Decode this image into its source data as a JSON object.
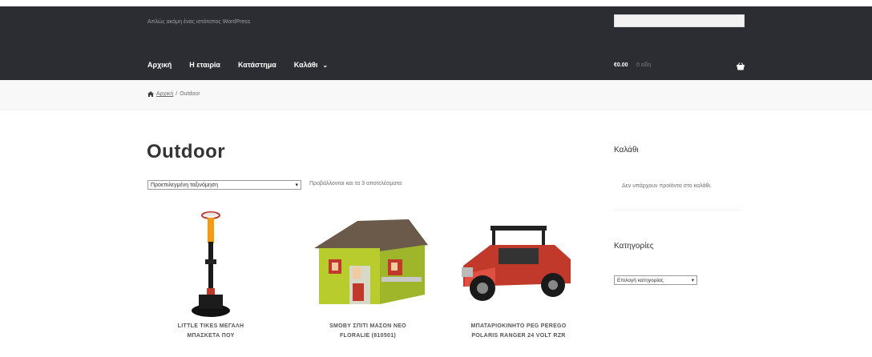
{
  "header": {
    "tagline": "Απλώς ακόμη ένας ιστότοπος WordPress",
    "nav": [
      {
        "label": "Αρχική"
      },
      {
        "label": "Η εταιρία"
      },
      {
        "label": "Κατάστημα"
      },
      {
        "label": "Καλάθι"
      }
    ],
    "cart_amount": "€0.00",
    "cart_items": "0 είδη"
  },
  "breadcrumb": {
    "home": "Αρχική",
    "separator": "/",
    "current": "Outdoor"
  },
  "main": {
    "title": "Outdoor",
    "sort_selected": "Προεπιλεγμένη ταξινόμηση",
    "result_count": "Προβάλλονται και τα 3 αποτελέσματα",
    "products": [
      {
        "title_line1": "LITTLE TIKES ΜΕΓΑΛΗ",
        "title_line2": "ΜΠΑΣΚΕΤΑ ΠΟΥ",
        "image": "basketball-hoop"
      },
      {
        "title_line1": "SMOBY ΣΠΙΤΙ ΜΑΣΟΝ ΝΕΟ",
        "title_line2": "FLORALIE (810501)",
        "image": "playhouse"
      },
      {
        "title_line1": "ΜΠΑΤΑΡΙΟΚΙΝΗΤΟ PEG PEREGO",
        "title_line2": "POLARIS RANGER 24 VOLT RZR",
        "image": "toy-jeep"
      }
    ]
  },
  "sidebar": {
    "cart_title": "Καλάθι",
    "cart_empty": "Δεν υπάρχουν προϊόντα στο καλάθι.",
    "categories_title": "Κατηγορίες",
    "categories_selected": "Επιλογή κατηγορίας"
  }
}
